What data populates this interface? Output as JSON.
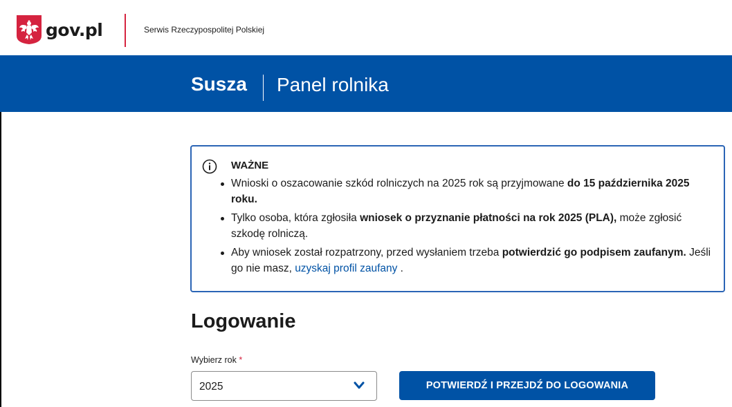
{
  "header": {
    "logo_text": "gov.pl",
    "service_name": "Serwis Rzeczypospolitej Polskiej"
  },
  "banner": {
    "title": "Susza",
    "subtitle": "Panel rolnika"
  },
  "notice": {
    "heading": "WAŻNE",
    "items": [
      {
        "text_before": "Wnioski o oszacowanie szkód rolniczych na 2025 rok są przyjmowane ",
        "bold": "do 15 października 2025 roku."
      },
      {
        "text_before": "Tylko osoba, która zgłosiła ",
        "bold": "wniosek o przyznanie płatności na rok 2025 (PLA),",
        "text_after": " może zgłosić szkodę rolniczą."
      },
      {
        "text_before": "Aby wniosek został rozpatrzony, przed wysłaniem trzeba ",
        "bold": "potwierdzić go podpisem zaufanym.",
        "text_after": " Jeśli go nie masz, ",
        "link": "uzyskaj profil zaufany",
        "text_end": " ."
      }
    ]
  },
  "login": {
    "heading": "Logowanie",
    "year_label": "Wybierz rok",
    "required_mark": "*",
    "year_value": "2025",
    "submit_label": "POTWIERDŹ I PRZEJDŹ DO LOGOWANIA"
  },
  "colors": {
    "brand_blue": "#0052a5",
    "accent_red": "#d5233f",
    "notice_border": "#2a64b5"
  }
}
